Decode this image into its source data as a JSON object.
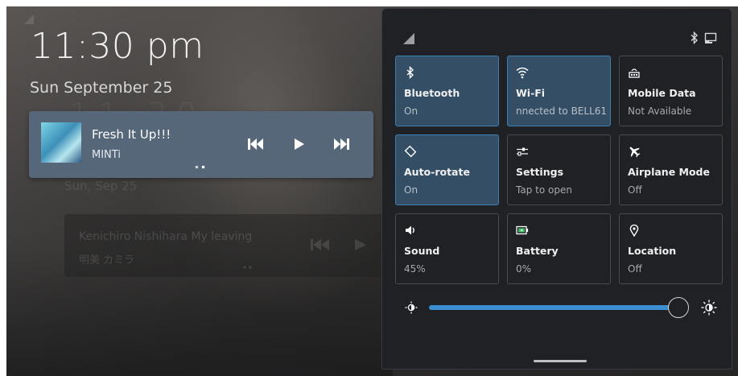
{
  "lockscreen": {
    "time": "11:30 pm",
    "date": "Sun September 25",
    "ghost_time": "1 1 : 3 0",
    "ghost_date": "Sun, Sep 25",
    "ghost_media": {
      "title": "Kenichiro Nishihara My leaving",
      "artist": "明美 カミラ"
    }
  },
  "media": {
    "title": "Fresh It Up!!!",
    "artist": "MINTi",
    "controls": {
      "prev": "skip-previous-icon",
      "play": "play-icon",
      "next": "skip-next-icon"
    },
    "page_count": 2,
    "active_page": 2
  },
  "quick_settings": {
    "status_icons": [
      "cellular-signal-icon",
      "bluetooth-icon",
      "screen-icon"
    ],
    "tiles": [
      {
        "id": "bluetooth",
        "label": "Bluetooth",
        "status": "On",
        "icon": "bluetooth-icon",
        "active": true
      },
      {
        "id": "wifi",
        "label": "Wi-Fi",
        "status": "nnected to BELL61",
        "icon": "wifi-icon",
        "active": true
      },
      {
        "id": "mobile-data",
        "label": "Mobile Data",
        "status": "Not Available",
        "icon": "mobile-data-icon",
        "active": false
      },
      {
        "id": "auto-rotate",
        "label": "Auto-rotate",
        "status": "On",
        "icon": "rotate-icon",
        "active": true
      },
      {
        "id": "settings",
        "label": "Settings",
        "status": "Tap to open",
        "icon": "settings-sliders-icon",
        "active": false
      },
      {
        "id": "airplane-mode",
        "label": "Airplane Mode",
        "status": "Off",
        "icon": "airplane-icon",
        "active": false
      },
      {
        "id": "sound",
        "label": "Sound",
        "status": "45%",
        "icon": "speaker-icon",
        "active": false
      },
      {
        "id": "battery",
        "label": "Battery",
        "status": "0%",
        "icon": "battery-icon",
        "active": false
      },
      {
        "id": "location",
        "label": "Location",
        "status": "Off",
        "icon": "location-pin-icon",
        "active": false
      }
    ],
    "brightness": {
      "value": 1.0,
      "low_icon": "brightness-low-icon",
      "high_icon": "brightness-high-icon"
    }
  },
  "colors": {
    "accent": "#3b8ed0",
    "tile_active_bg": "#344e65",
    "tile_active_border": "#3b7fb3",
    "panel_bg": "#202124",
    "media_card_bg": "#566779"
  }
}
